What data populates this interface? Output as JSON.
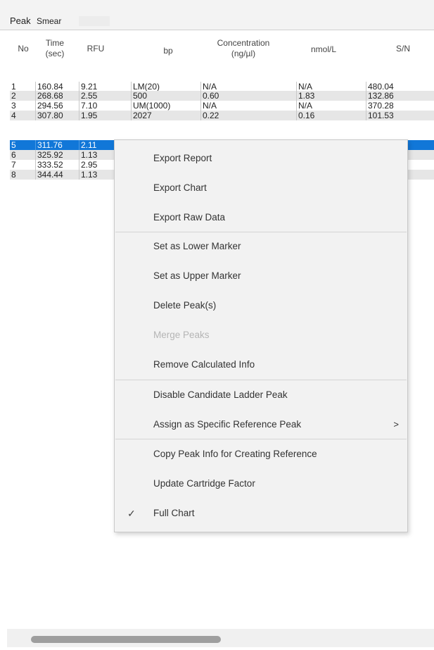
{
  "tabs": [
    {
      "label": "Peak"
    },
    {
      "label": "Smear"
    },
    {
      "label": ""
    }
  ],
  "table": {
    "headers": {
      "no": "No",
      "time": "Time\n(sec)",
      "rfu": "RFU",
      "bp": "bp",
      "concentration": "Concentration\n(ng/µl)",
      "nmol": "nmol/L",
      "sn": "S/N"
    },
    "rows": [
      {
        "no": "1",
        "time": "160.84",
        "rfu": "9.21",
        "bp": "LM(20)",
        "conc": "N/A",
        "nmol": "N/A",
        "sn": "480.04"
      },
      {
        "no": "2",
        "time": "268.68",
        "rfu": "2.55",
        "bp": "500",
        "conc": "0.60",
        "nmol": "1.83",
        "sn": "132.86"
      },
      {
        "no": "3",
        "time": "294.56",
        "rfu": "7.10",
        "bp": "UM(1000)",
        "conc": "N/A",
        "nmol": "N/A",
        "sn": "370.28"
      },
      {
        "no": "4",
        "time": "307.80",
        "rfu": "1.95",
        "bp": "2027",
        "conc": "0.22",
        "nmol": "0.16",
        "sn": "101.53"
      },
      {
        "no": "5",
        "time": "311.76",
        "rfu": "2.11",
        "bp": "",
        "conc": "",
        "nmol": "",
        "sn": ""
      },
      {
        "no": "6",
        "time": "325.92",
        "rfu": "1.13",
        "bp": "",
        "conc": "",
        "nmol": "",
        "sn": ""
      },
      {
        "no": "7",
        "time": "333.52",
        "rfu": "2.95",
        "bp": "",
        "conc": "",
        "nmol": "",
        "sn": ""
      },
      {
        "no": "8",
        "time": "344.44",
        "rfu": "1.13",
        "bp": "",
        "conc": "",
        "nmol": "",
        "sn": ""
      }
    ]
  },
  "context_menu": {
    "items": [
      {
        "label": "Export Report",
        "enabled": true
      },
      {
        "label": "Export Chart",
        "enabled": true
      },
      {
        "label": "Export Raw Data",
        "enabled": true
      },
      {
        "label": "Set as Lower Marker",
        "enabled": true
      },
      {
        "label": "Set as Upper Marker",
        "enabled": true
      },
      {
        "label": "Delete Peak(s)",
        "enabled": true
      },
      {
        "label": "Merge Peaks",
        "enabled": false
      },
      {
        "label": "Remove Calculated Info",
        "enabled": true
      },
      {
        "label": "Disable Candidate Ladder Peak",
        "enabled": true
      },
      {
        "label": "Assign as Specific Reference Peak",
        "enabled": true,
        "submenu_glyph": ">"
      },
      {
        "label": "Copy Peak Info for Creating Reference",
        "enabled": true
      },
      {
        "label": "Update Cartridge Factor",
        "enabled": true
      },
      {
        "label": "Full Chart",
        "enabled": true,
        "checked": true,
        "check_glyph": "✓"
      }
    ]
  },
  "selected_row_index": 4,
  "colors": {
    "selection": "#1177d8",
    "alt_row": "#e6e6e6",
    "menu_bg": "#f2f2f2"
  }
}
